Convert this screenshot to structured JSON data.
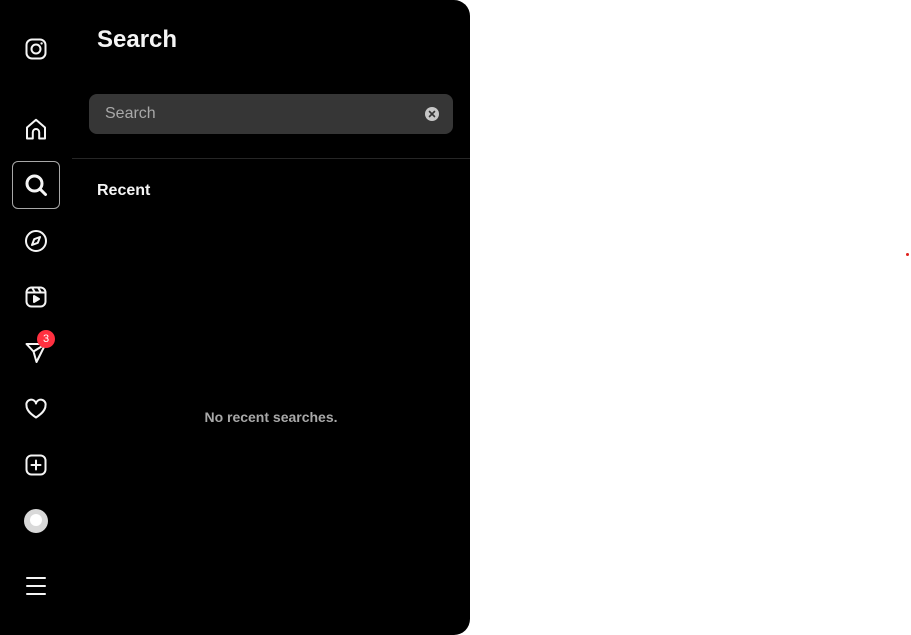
{
  "sidebar": {
    "items": [
      {
        "name": "instagram-logo",
        "icon": "instagram-icon"
      },
      {
        "name": "home",
        "icon": "home-icon"
      },
      {
        "name": "search",
        "icon": "search-icon",
        "active": true
      },
      {
        "name": "explore",
        "icon": "compass-icon"
      },
      {
        "name": "reels",
        "icon": "reels-icon"
      },
      {
        "name": "messages",
        "icon": "send-icon",
        "badge": "3"
      },
      {
        "name": "notifications",
        "icon": "heart-icon"
      },
      {
        "name": "create",
        "icon": "plus-square-icon"
      },
      {
        "name": "profile",
        "icon": "avatar"
      },
      {
        "name": "more",
        "icon": "menu-icon"
      }
    ],
    "badge_color": "#ff3040"
  },
  "search_panel": {
    "title": "Search",
    "input": {
      "placeholder": "Search",
      "value": ""
    },
    "recent_heading": "Recent",
    "empty_message": "No recent searches."
  },
  "colors": {
    "panel_bg": "#000000",
    "input_bg": "#363636",
    "text_primary": "#f5f5f5",
    "text_secondary": "#a8a8a8",
    "active_border": "#a8a8a8"
  }
}
